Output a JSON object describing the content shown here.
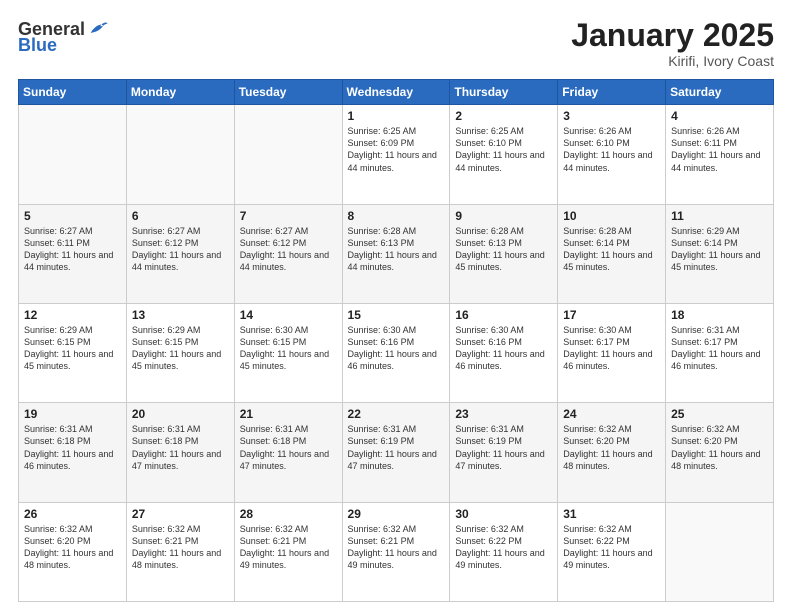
{
  "header": {
    "logo_general": "General",
    "logo_blue": "Blue",
    "month_title": "January 2025",
    "location": "Kirifi, Ivory Coast"
  },
  "days_of_week": [
    "Sunday",
    "Monday",
    "Tuesday",
    "Wednesday",
    "Thursday",
    "Friday",
    "Saturday"
  ],
  "weeks": [
    [
      {
        "day": "",
        "info": ""
      },
      {
        "day": "",
        "info": ""
      },
      {
        "day": "",
        "info": ""
      },
      {
        "day": "1",
        "info": "Sunrise: 6:25 AM\nSunset: 6:09 PM\nDaylight: 11 hours and 44 minutes."
      },
      {
        "day": "2",
        "info": "Sunrise: 6:25 AM\nSunset: 6:10 PM\nDaylight: 11 hours and 44 minutes."
      },
      {
        "day": "3",
        "info": "Sunrise: 6:26 AM\nSunset: 6:10 PM\nDaylight: 11 hours and 44 minutes."
      },
      {
        "day": "4",
        "info": "Sunrise: 6:26 AM\nSunset: 6:11 PM\nDaylight: 11 hours and 44 minutes."
      }
    ],
    [
      {
        "day": "5",
        "info": "Sunrise: 6:27 AM\nSunset: 6:11 PM\nDaylight: 11 hours and 44 minutes."
      },
      {
        "day": "6",
        "info": "Sunrise: 6:27 AM\nSunset: 6:12 PM\nDaylight: 11 hours and 44 minutes."
      },
      {
        "day": "7",
        "info": "Sunrise: 6:27 AM\nSunset: 6:12 PM\nDaylight: 11 hours and 44 minutes."
      },
      {
        "day": "8",
        "info": "Sunrise: 6:28 AM\nSunset: 6:13 PM\nDaylight: 11 hours and 44 minutes."
      },
      {
        "day": "9",
        "info": "Sunrise: 6:28 AM\nSunset: 6:13 PM\nDaylight: 11 hours and 45 minutes."
      },
      {
        "day": "10",
        "info": "Sunrise: 6:28 AM\nSunset: 6:14 PM\nDaylight: 11 hours and 45 minutes."
      },
      {
        "day": "11",
        "info": "Sunrise: 6:29 AM\nSunset: 6:14 PM\nDaylight: 11 hours and 45 minutes."
      }
    ],
    [
      {
        "day": "12",
        "info": "Sunrise: 6:29 AM\nSunset: 6:15 PM\nDaylight: 11 hours and 45 minutes."
      },
      {
        "day": "13",
        "info": "Sunrise: 6:29 AM\nSunset: 6:15 PM\nDaylight: 11 hours and 45 minutes."
      },
      {
        "day": "14",
        "info": "Sunrise: 6:30 AM\nSunset: 6:15 PM\nDaylight: 11 hours and 45 minutes."
      },
      {
        "day": "15",
        "info": "Sunrise: 6:30 AM\nSunset: 6:16 PM\nDaylight: 11 hours and 46 minutes."
      },
      {
        "day": "16",
        "info": "Sunrise: 6:30 AM\nSunset: 6:16 PM\nDaylight: 11 hours and 46 minutes."
      },
      {
        "day": "17",
        "info": "Sunrise: 6:30 AM\nSunset: 6:17 PM\nDaylight: 11 hours and 46 minutes."
      },
      {
        "day": "18",
        "info": "Sunrise: 6:31 AM\nSunset: 6:17 PM\nDaylight: 11 hours and 46 minutes."
      }
    ],
    [
      {
        "day": "19",
        "info": "Sunrise: 6:31 AM\nSunset: 6:18 PM\nDaylight: 11 hours and 46 minutes."
      },
      {
        "day": "20",
        "info": "Sunrise: 6:31 AM\nSunset: 6:18 PM\nDaylight: 11 hours and 47 minutes."
      },
      {
        "day": "21",
        "info": "Sunrise: 6:31 AM\nSunset: 6:18 PM\nDaylight: 11 hours and 47 minutes."
      },
      {
        "day": "22",
        "info": "Sunrise: 6:31 AM\nSunset: 6:19 PM\nDaylight: 11 hours and 47 minutes."
      },
      {
        "day": "23",
        "info": "Sunrise: 6:31 AM\nSunset: 6:19 PM\nDaylight: 11 hours and 47 minutes."
      },
      {
        "day": "24",
        "info": "Sunrise: 6:32 AM\nSunset: 6:20 PM\nDaylight: 11 hours and 48 minutes."
      },
      {
        "day": "25",
        "info": "Sunrise: 6:32 AM\nSunset: 6:20 PM\nDaylight: 11 hours and 48 minutes."
      }
    ],
    [
      {
        "day": "26",
        "info": "Sunrise: 6:32 AM\nSunset: 6:20 PM\nDaylight: 11 hours and 48 minutes."
      },
      {
        "day": "27",
        "info": "Sunrise: 6:32 AM\nSunset: 6:21 PM\nDaylight: 11 hours and 48 minutes."
      },
      {
        "day": "28",
        "info": "Sunrise: 6:32 AM\nSunset: 6:21 PM\nDaylight: 11 hours and 49 minutes."
      },
      {
        "day": "29",
        "info": "Sunrise: 6:32 AM\nSunset: 6:21 PM\nDaylight: 11 hours and 49 minutes."
      },
      {
        "day": "30",
        "info": "Sunrise: 6:32 AM\nSunset: 6:22 PM\nDaylight: 11 hours and 49 minutes."
      },
      {
        "day": "31",
        "info": "Sunrise: 6:32 AM\nSunset: 6:22 PM\nDaylight: 11 hours and 49 minutes."
      },
      {
        "day": "",
        "info": ""
      }
    ]
  ]
}
